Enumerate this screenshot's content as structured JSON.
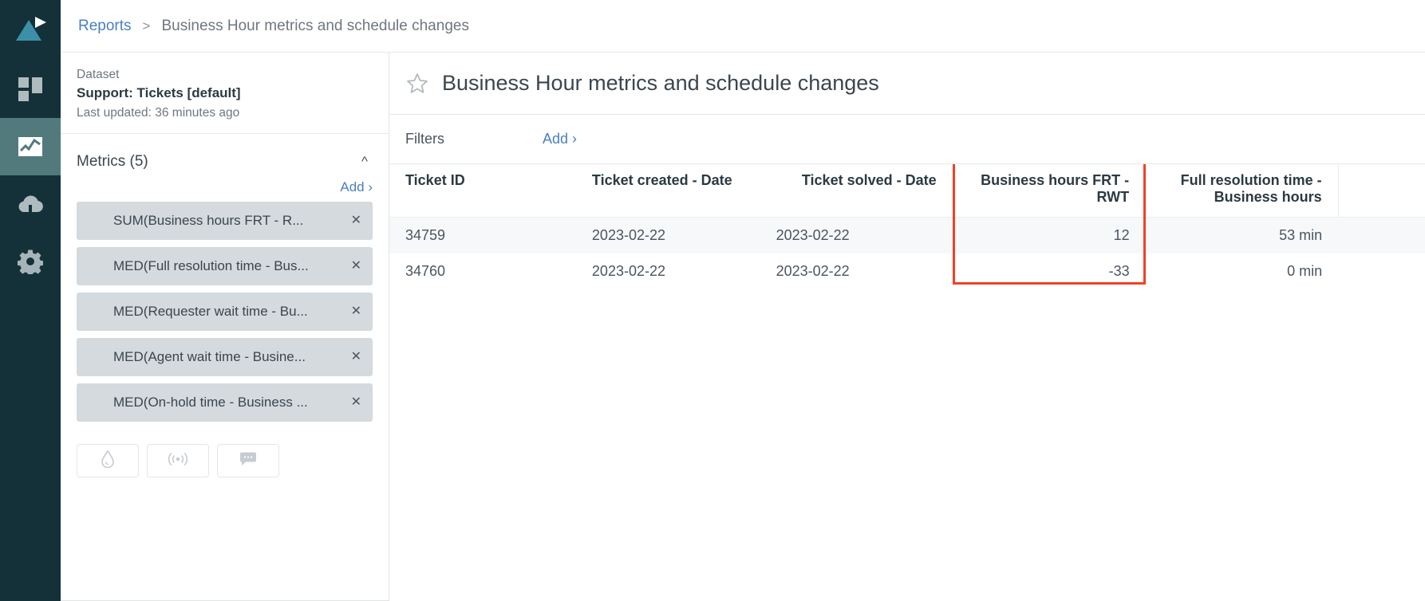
{
  "rail": {
    "logo_icon": "triangle-play-logo",
    "items": [
      {
        "icon": "dashboard-grid-icon",
        "name": "dashboards",
        "active": false
      },
      {
        "icon": "line-chart-icon",
        "name": "reports",
        "active": true
      },
      {
        "icon": "cloud-upload-icon",
        "name": "data-import",
        "active": false
      },
      {
        "icon": "gear-icon",
        "name": "settings",
        "active": false
      }
    ]
  },
  "breadcrumb": {
    "root": "Reports",
    "separator": ">",
    "current": "Business Hour metrics and schedule changes"
  },
  "panel": {
    "dataset": {
      "label": "Dataset",
      "name": "Support: Tickets [default]",
      "updated": "Last updated: 36 minutes ago"
    },
    "metrics": {
      "title": "Metrics (5)",
      "collapse_icon": "chevron-up-icon",
      "add_label": "Add ›",
      "remove_icon": "close-icon",
      "items": [
        {
          "label": "SUM(Business hours FRT - R..."
        },
        {
          "label": "MED(Full resolution time - Bus..."
        },
        {
          "label": "MED(Requester wait time - Bu..."
        },
        {
          "label": "MED(Agent wait time - Busine..."
        },
        {
          "label": "MED(On-hold time - Business ..."
        }
      ]
    },
    "tools": [
      {
        "icon": "droplet-icon",
        "name": "drill-through-button"
      },
      {
        "icon": "broadcast-icon",
        "name": "alerts-button"
      },
      {
        "icon": "comment-icon",
        "name": "comments-button"
      }
    ]
  },
  "main": {
    "favorite_icon": "star-outline-icon",
    "title": "Business Hour metrics and schedule changes",
    "filters": {
      "label": "Filters",
      "add_label": "Add ›"
    }
  },
  "table": {
    "columns": [
      {
        "label": "Ticket ID",
        "align": "left"
      },
      {
        "label": "Ticket created - Date",
        "align": "left"
      },
      {
        "label": "Ticket solved - Date",
        "align": "left"
      },
      {
        "label": "Business hours FRT - RWT",
        "align": "right"
      },
      {
        "label": "Full resolution time - Business hours",
        "align": "right"
      }
    ],
    "rows": [
      {
        "ticket_id": "34759",
        "created": "2023-02-22",
        "solved": "2023-02-22",
        "frt_rwt": "12",
        "full_resolution": "53 min"
      },
      {
        "ticket_id": "34760",
        "created": "2023-02-22",
        "solved": "2023-02-22",
        "frt_rwt": "-33",
        "full_resolution": "0 min"
      }
    ]
  },
  "annotation": {
    "highlight_color": "#f04124",
    "highlight_target": "Business hours FRT - RWT"
  },
  "colors": {
    "rail_bg": "#143139",
    "rail_active": "#527a7c",
    "link": "#4a7fc1",
    "chip_bg": "#d4dade",
    "text_dark": "#2b3a42"
  }
}
